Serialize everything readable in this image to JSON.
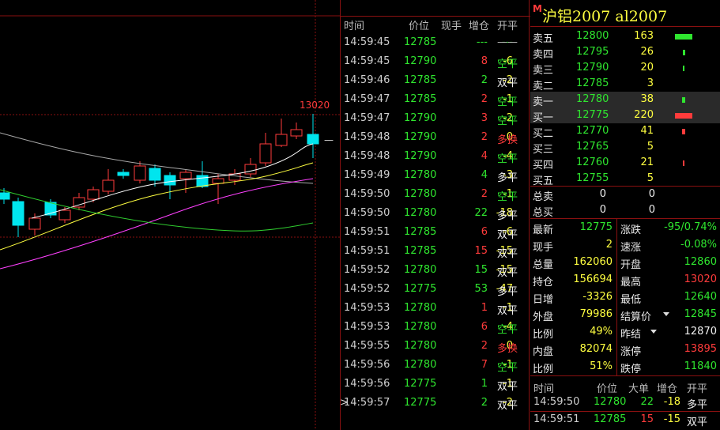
{
  "chart": {
    "high_label": "13020",
    "price_marker": "—"
  },
  "ticks": {
    "headers": [
      "时间",
      "价位",
      "现手",
      "增仓",
      "开平"
    ],
    "rows": [
      {
        "time": "14:59:45",
        "price": "12785",
        "vol": "---",
        "chg": "---",
        "type": "——",
        "vc": "green",
        "cc": "green",
        "tc": "grey"
      },
      {
        "time": "14:59:45",
        "price": "12790",
        "vol": "8",
        "chg": "-6",
        "type": "空平",
        "vc": "red",
        "cc": "yellow",
        "tc": "green"
      },
      {
        "time": "14:59:46",
        "price": "12785",
        "vol": "2",
        "chg": "-2",
        "type": "双平",
        "vc": "green",
        "cc": "yellow",
        "tc": "white"
      },
      {
        "time": "14:59:47",
        "price": "12785",
        "vol": "2",
        "chg": "-1",
        "type": "空平",
        "vc": "red",
        "cc": "yellow",
        "tc": "green"
      },
      {
        "time": "14:59:47",
        "price": "12790",
        "vol": "3",
        "chg": "-2",
        "type": "空平",
        "vc": "red",
        "cc": "yellow",
        "tc": "green"
      },
      {
        "time": "14:59:48",
        "price": "12790",
        "vol": "2",
        "chg": "0",
        "type": "多换",
        "vc": "red",
        "cc": "yellow",
        "tc": "red"
      },
      {
        "time": "14:59:48",
        "price": "12790",
        "vol": "4",
        "chg": "-4",
        "type": "空平",
        "vc": "red",
        "cc": "yellow",
        "tc": "green"
      },
      {
        "time": "14:59:49",
        "price": "12780",
        "vol": "4",
        "chg": "-3",
        "type": "多平",
        "vc": "green",
        "cc": "yellow",
        "tc": "white"
      },
      {
        "time": "14:59:50",
        "price": "12780",
        "vol": "2",
        "chg": "-1",
        "type": "空平",
        "vc": "red",
        "cc": "yellow",
        "tc": "green"
      },
      {
        "time": "14:59:50",
        "price": "12780",
        "vol": "22",
        "chg": "-18",
        "type": "多平",
        "vc": "green",
        "cc": "yellow",
        "tc": "white"
      },
      {
        "time": "14:59:51",
        "price": "12785",
        "vol": "6",
        "chg": "-6",
        "type": "双平",
        "vc": "red",
        "cc": "yellow",
        "tc": "white"
      },
      {
        "time": "14:59:51",
        "price": "12785",
        "vol": "15",
        "chg": "-15",
        "type": "双平",
        "vc": "red",
        "cc": "yellow",
        "tc": "white"
      },
      {
        "time": "14:59:52",
        "price": "12780",
        "vol": "15",
        "chg": "-15",
        "type": "双平",
        "vc": "green",
        "cc": "yellow",
        "tc": "white"
      },
      {
        "time": "14:59:52",
        "price": "12775",
        "vol": "53",
        "chg": "-47",
        "type": "多平",
        "vc": "green",
        "cc": "yellow",
        "tc": "white"
      },
      {
        "time": "14:59:53",
        "price": "12780",
        "vol": "1",
        "chg": "-1",
        "type": "双平",
        "vc": "red",
        "cc": "yellow",
        "tc": "white"
      },
      {
        "time": "14:59:53",
        "price": "12780",
        "vol": "6",
        "chg": "-4",
        "type": "空平",
        "vc": "red",
        "cc": "yellow",
        "tc": "green"
      },
      {
        "time": "14:59:55",
        "price": "12780",
        "vol": "2",
        "chg": "0",
        "type": "多换",
        "vc": "red",
        "cc": "yellow",
        "tc": "red"
      },
      {
        "time": "14:59:56",
        "price": "12780",
        "vol": "7",
        "chg": "-1",
        "type": "空平",
        "vc": "red",
        "cc": "yellow",
        "tc": "green"
      },
      {
        "time": "14:59:56",
        "price": "12775",
        "vol": "1",
        "chg": "-1",
        "type": "双平",
        "vc": "green",
        "cc": "yellow",
        "tc": "white"
      },
      {
        "time": "14:59:57",
        "price": "12775",
        "vol": "2",
        "chg": "-2",
        "type": "双平",
        "vc": "green",
        "cc": "yellow",
        "tc": "white"
      }
    ],
    "cursor": ">"
  },
  "quote": {
    "badge": "M",
    "title": "沪铝2007  al2007",
    "asks": [
      {
        "label": "卖五",
        "price": "12800",
        "vol": "163",
        "bar": "green",
        "bar_frac": 1.0
      },
      {
        "label": "卖四",
        "price": "12795",
        "vol": "26",
        "bar": "green",
        "bar_frac": 0.12
      },
      {
        "label": "卖三",
        "price": "12790",
        "vol": "20",
        "bar": "green",
        "bar_frac": 0.1
      },
      {
        "label": "卖二",
        "price": "12785",
        "vol": "3",
        "bar": "none",
        "bar_frac": 0
      },
      {
        "label": "卖一",
        "price": "12780",
        "vol": "38",
        "bar": "green",
        "bar_frac": 0.17
      }
    ],
    "bids": [
      {
        "label": "买一",
        "price": "12775",
        "vol": "220",
        "bar": "red",
        "bar_frac": 1.0
      },
      {
        "label": "买二",
        "price": "12770",
        "vol": "41",
        "bar": "red",
        "bar_frac": 0.17
      },
      {
        "label": "买三",
        "price": "12765",
        "vol": "5",
        "bar": "none",
        "bar_frac": 0
      },
      {
        "label": "买四",
        "price": "12760",
        "vol": "21",
        "bar": "red",
        "bar_frac": 0.1
      },
      {
        "label": "买五",
        "price": "12755",
        "vol": "5",
        "bar": "none",
        "bar_frac": 0
      }
    ],
    "totals": [
      {
        "label": "总卖",
        "v1": "0",
        "v2": "0"
      },
      {
        "label": "总买",
        "v1": "0",
        "v2": "0"
      }
    ],
    "stats": [
      {
        "l1": "最新",
        "v1": "12775",
        "c1": "green",
        "l2": "涨跌",
        "v2": "-95/0.74%",
        "c2": "green"
      },
      {
        "l1": "现手",
        "v1": "2",
        "c1": "yellow",
        "l2": "速涨",
        "v2": "-0.08%",
        "c2": "green"
      },
      {
        "l1": "总量",
        "v1": "162060",
        "c1": "yellow",
        "l2": "开盘",
        "v2": "12860",
        "c2": "green"
      },
      {
        "l1": "持仓",
        "v1": "156694",
        "c1": "yellow",
        "l2": "最高",
        "v2": "13020",
        "c2": "red"
      },
      {
        "l1": "日增",
        "v1": "-3326",
        "c1": "yellow",
        "l2": "最低",
        "v2": "12640",
        "c2": "green"
      },
      {
        "l1": "外盘",
        "v1": "79986",
        "c1": "yellow",
        "l2": "结算价",
        "v2": "12845",
        "c2": "green"
      },
      {
        "l1": "比例",
        "v1": "49%",
        "c1": "yellow",
        "l2": "昨结",
        "v2": "12870",
        "c2": "white"
      },
      {
        "l1": "内盘",
        "v1": "82074",
        "c1": "yellow",
        "l2": "涨停",
        "v2": "13895",
        "c2": "red"
      },
      {
        "l1": "比例",
        "v1": "51%",
        "c1": "yellow",
        "l2": "跌停",
        "v2": "11840",
        "c2": "green"
      }
    ],
    "mini_headers": [
      "时间",
      "价位",
      "大单",
      "增仓",
      "开平"
    ],
    "mini_rows": [
      {
        "time": "14:59:50",
        "price": "12780",
        "vol": "22",
        "chg": "-18",
        "type": "多平",
        "vc": "green"
      },
      {
        "time": "14:59:51",
        "price": "12785",
        "vol": "15",
        "chg": "-15",
        "type": "双平",
        "vc": "red"
      }
    ]
  }
}
